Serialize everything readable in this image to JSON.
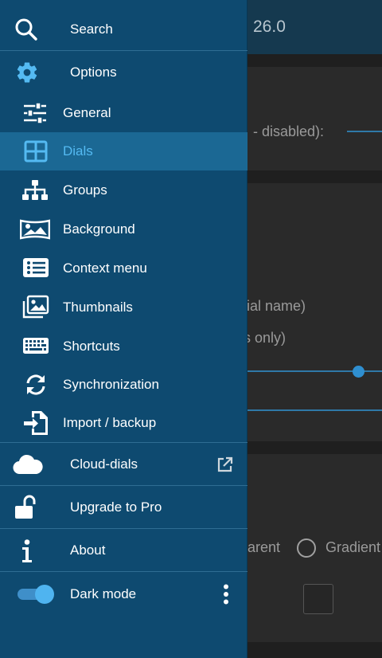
{
  "background_app": {
    "version": "26.0",
    "disabled_label": "- disabled):",
    "dial_name_label": "dial name)",
    "only_label": "s only)",
    "transparent_option": "arent",
    "gradient_option": "Gradient"
  },
  "drawer": {
    "search": {
      "label": "Search",
      "icon": "search-icon"
    },
    "options": {
      "label": "Options",
      "icon": "gear-icon"
    },
    "items": [
      {
        "label": "General",
        "icon": "sliders-icon"
      },
      {
        "label": "Dials",
        "icon": "grid-icon",
        "active": true
      },
      {
        "label": "Groups",
        "icon": "sitemap-icon"
      },
      {
        "label": "Background",
        "icon": "panorama-icon"
      },
      {
        "label": "Context menu",
        "icon": "list-icon"
      },
      {
        "label": "Thumbnails",
        "icon": "images-icon"
      },
      {
        "label": "Shortcuts",
        "icon": "keyboard-icon"
      },
      {
        "label": "Synchronization",
        "icon": "sync-icon"
      },
      {
        "label": "Import / backup",
        "icon": "file-import-icon"
      }
    ],
    "cloud_dials": {
      "label": "Cloud-dials",
      "icon": "cloud-icon",
      "trailing_icon": "external-link-icon"
    },
    "upgrade": {
      "label": "Upgrade to Pro",
      "icon": "unlock-icon"
    },
    "about": {
      "label": "About",
      "icon": "info-icon"
    },
    "dark_mode": {
      "label": "Dark mode",
      "enabled": true,
      "trailing_icon": "more-vert-icon"
    }
  },
  "colors": {
    "drawer_bg": "#0e4a70",
    "active_bg": "#1b6894",
    "active_text": "#54baf2",
    "icon_blue": "#54baf2",
    "toggle_track": "#3f8fc9",
    "toggle_thumb": "#4fb4f0"
  }
}
